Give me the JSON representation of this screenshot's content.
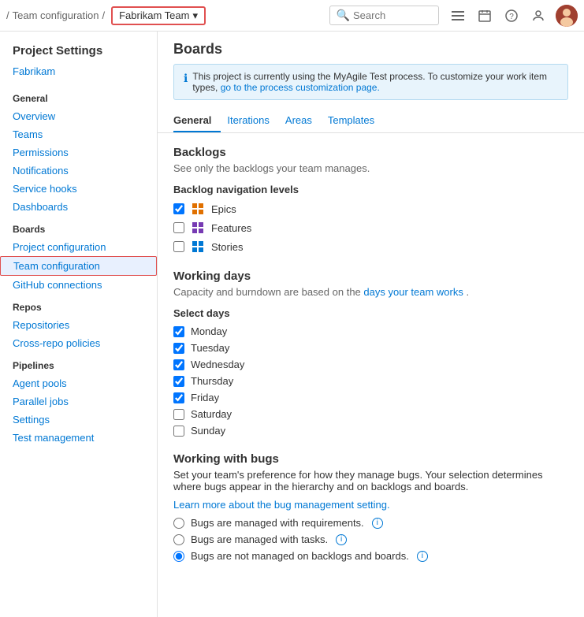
{
  "topbar": {
    "breadcrumb_slash1": "/",
    "breadcrumb_team_config": "Team configuration",
    "breadcrumb_slash2": "/",
    "team_selector_label": "Fabrikam Team",
    "team_selector_chevron": "▾",
    "search_placeholder": "Search",
    "icons": [
      "list-icon",
      "calendar-icon",
      "help-icon",
      "person-icon"
    ]
  },
  "sidebar": {
    "title": "Project Settings",
    "project_link": "Fabrikam",
    "sections": [
      {
        "label": "General",
        "items": [
          {
            "id": "overview",
            "label": "Overview",
            "active": false
          },
          {
            "id": "teams",
            "label": "Teams",
            "active": false
          },
          {
            "id": "permissions",
            "label": "Permissions",
            "active": false
          },
          {
            "id": "notifications",
            "label": "Notifications",
            "active": false
          },
          {
            "id": "service-hooks",
            "label": "Service hooks",
            "active": false
          },
          {
            "id": "dashboards",
            "label": "Dashboards",
            "active": false
          }
        ]
      },
      {
        "label": "Boards",
        "items": [
          {
            "id": "project-configuration",
            "label": "Project configuration",
            "active": false
          },
          {
            "id": "team-configuration",
            "label": "Team configuration",
            "active": true
          },
          {
            "id": "github-connections",
            "label": "GitHub connections",
            "active": false
          }
        ]
      },
      {
        "label": "Repos",
        "items": [
          {
            "id": "repositories",
            "label": "Repositories",
            "active": false
          },
          {
            "id": "cross-repo-policies",
            "label": "Cross-repo policies",
            "active": false
          }
        ]
      },
      {
        "label": "Pipelines",
        "items": [
          {
            "id": "agent-pools",
            "label": "Agent pools",
            "active": false
          },
          {
            "id": "parallel-jobs",
            "label": "Parallel jobs",
            "active": false
          },
          {
            "id": "settings",
            "label": "Settings",
            "active": false
          },
          {
            "id": "test-management",
            "label": "Test management",
            "active": false
          }
        ]
      }
    ]
  },
  "content": {
    "title": "Boards",
    "info_banner": "This project is currently using the MyAgile Test process. To customize your work item types,",
    "info_banner_link": "go to the process customization page.",
    "tabs": [
      {
        "id": "general",
        "label": "General",
        "active": true
      },
      {
        "id": "iterations",
        "label": "Iterations",
        "active": false
      },
      {
        "id": "areas",
        "label": "Areas",
        "active": false
      },
      {
        "id": "templates",
        "label": "Templates",
        "active": false
      }
    ],
    "backlogs": {
      "title": "Backlogs",
      "desc": "See only the backlogs your team manages.",
      "nav_levels_label": "Backlog navigation levels",
      "items": [
        {
          "id": "epics",
          "label": "Epics",
          "checked": true,
          "icon": "epics"
        },
        {
          "id": "features",
          "label": "Features",
          "checked": false,
          "icon": "features"
        },
        {
          "id": "stories",
          "label": "Stories",
          "checked": false,
          "icon": "stories"
        }
      ]
    },
    "working_days": {
      "title": "Working days",
      "desc_prefix": "Capacity and burndown are based on the",
      "desc_link": "days your team works",
      "desc_suffix": ".",
      "select_days_label": "Select days",
      "days": [
        {
          "id": "monday",
          "label": "Monday",
          "checked": true
        },
        {
          "id": "tuesday",
          "label": "Tuesday",
          "checked": true
        },
        {
          "id": "wednesday",
          "label": "Wednesday",
          "checked": true
        },
        {
          "id": "thursday",
          "label": "Thursday",
          "checked": true
        },
        {
          "id": "friday",
          "label": "Friday",
          "checked": true
        },
        {
          "id": "saturday",
          "label": "Saturday",
          "checked": false
        },
        {
          "id": "sunday",
          "label": "Sunday",
          "checked": false
        }
      ]
    },
    "working_with_bugs": {
      "title": "Working with bugs",
      "desc": "Set your team's preference for how they manage bugs. Your selection determines where bugs appear in the hierarchy and on backlogs and boards.",
      "learn_more_link": "Learn more about the bug management setting.",
      "options": [
        {
          "id": "bugs-requirements",
          "label": "Bugs are managed with requirements.",
          "checked": false
        },
        {
          "id": "bugs-tasks",
          "label": "Bugs are managed with tasks.",
          "checked": false
        },
        {
          "id": "bugs-not-managed",
          "label": "Bugs are not managed on backlogs and boards.",
          "checked": true
        }
      ]
    }
  }
}
